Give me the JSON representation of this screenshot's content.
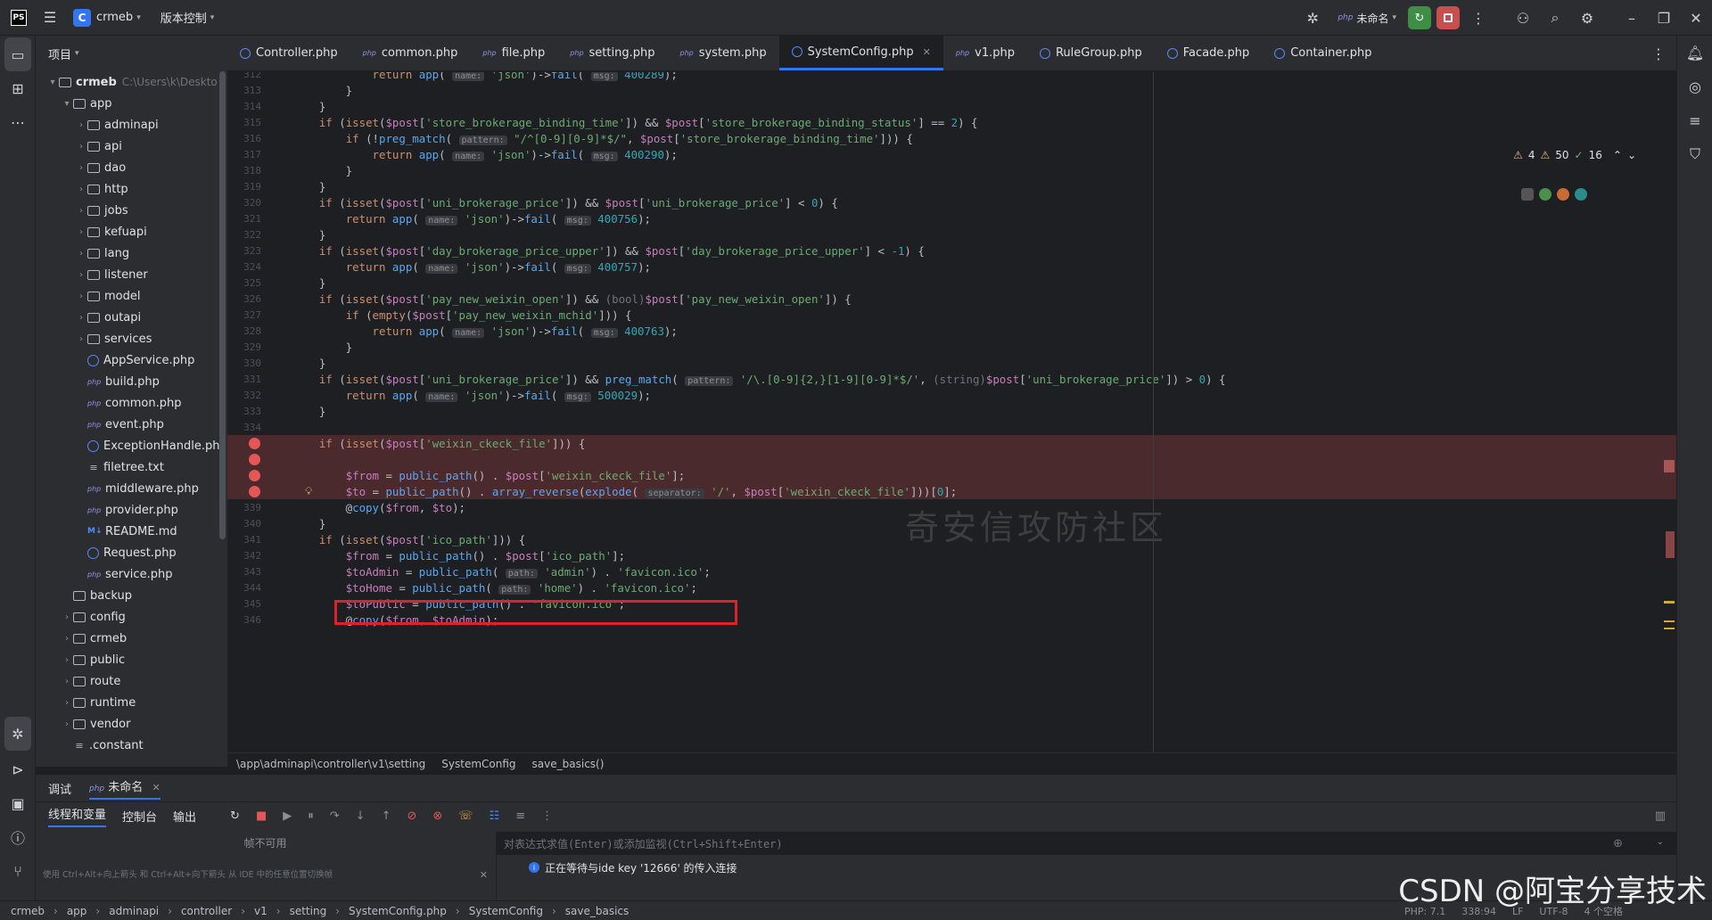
{
  "titlebar": {
    "logo_text": "PS",
    "project_badge": "C",
    "project_name": "crmeb",
    "vcs_label": "版本控制",
    "run_config": "未命名"
  },
  "project_panel": {
    "header": "项目",
    "root_name": "crmeb",
    "root_path": "C:\\Users\\k\\Deskto",
    "items": [
      {
        "name": "app",
        "type": "folder",
        "depth": 1,
        "open": true
      },
      {
        "name": "adminapi",
        "type": "folder",
        "depth": 2
      },
      {
        "name": "api",
        "type": "folder",
        "depth": 2
      },
      {
        "name": "dao",
        "type": "folder",
        "depth": 2
      },
      {
        "name": "http",
        "type": "folder",
        "depth": 2
      },
      {
        "name": "jobs",
        "type": "folder",
        "depth": 2
      },
      {
        "name": "kefuapi",
        "type": "folder",
        "depth": 2
      },
      {
        "name": "lang",
        "type": "folder",
        "depth": 2
      },
      {
        "name": "listener",
        "type": "folder",
        "depth": 2
      },
      {
        "name": "model",
        "type": "folder",
        "depth": 2
      },
      {
        "name": "outapi",
        "type": "folder",
        "depth": 2
      },
      {
        "name": "services",
        "type": "folder",
        "depth": 2
      },
      {
        "name": "AppService.php",
        "type": "class",
        "depth": 2
      },
      {
        "name": "build.php",
        "type": "php",
        "depth": 2
      },
      {
        "name": "common.php",
        "type": "php",
        "depth": 2
      },
      {
        "name": "event.php",
        "type": "php",
        "depth": 2
      },
      {
        "name": "ExceptionHandle.ph",
        "type": "class",
        "depth": 2
      },
      {
        "name": "filetree.txt",
        "type": "txt",
        "depth": 2
      },
      {
        "name": "middleware.php",
        "type": "php",
        "depth": 2
      },
      {
        "name": "provider.php",
        "type": "php",
        "depth": 2
      },
      {
        "name": "README.md",
        "type": "md",
        "depth": 2
      },
      {
        "name": "Request.php",
        "type": "class",
        "depth": 2
      },
      {
        "name": "service.php",
        "type": "php",
        "depth": 2
      },
      {
        "name": "backup",
        "type": "folder-noarrow",
        "depth": 1
      },
      {
        "name": "config",
        "type": "folder",
        "depth": 1
      },
      {
        "name": "crmeb",
        "type": "folder",
        "depth": 1
      },
      {
        "name": "public",
        "type": "folder",
        "depth": 1
      },
      {
        "name": "route",
        "type": "folder",
        "depth": 1
      },
      {
        "name": "runtime",
        "type": "folder",
        "depth": 1
      },
      {
        "name": "vendor",
        "type": "folder",
        "depth": 1
      },
      {
        "name": ".constant",
        "type": "txt",
        "depth": 1
      }
    ]
  },
  "tabs": [
    {
      "label": "Controller.php",
      "icon": "class"
    },
    {
      "label": "common.php",
      "icon": "php"
    },
    {
      "label": "file.php",
      "icon": "php"
    },
    {
      "label": "setting.php",
      "icon": "php"
    },
    {
      "label": "system.php",
      "icon": "php"
    },
    {
      "label": "SystemConfig.php",
      "icon": "class",
      "active": true
    },
    {
      "label": "v1.php",
      "icon": "php"
    },
    {
      "label": "RuleGroup.php",
      "icon": "class"
    },
    {
      "label": "Facade.php",
      "icon": "class"
    },
    {
      "label": "Container.php",
      "icon": "class"
    }
  ],
  "inspections": {
    "warnings_a": "4",
    "warnings_b": "50",
    "ok": "16"
  },
  "watermark": "奇安信攻防社区",
  "editor_breadcrumb": [
    "\\app\\adminapi\\controller\\v1\\setting",
    "SystemConfig",
    "save_basics()"
  ],
  "code_lines": [
    {
      "n": "312",
      "html": "            <span class='kw'>return</span> <span class='fn'>app</span>( <span class='hint'>name:</span> <span class='str'>'json'</span>)-&gt;<span class='fn'>fail</span>( <span class='hint'>msg:</span> <span class='num'>400289</span>);"
    },
    {
      "n": "313",
      "html": "        }"
    },
    {
      "n": "314",
      "html": "    }"
    },
    {
      "n": "315",
      "html": "    <span class='kw'>if</span> (<span class='kw'>isset</span>(<span class='var'>$post</span>[<span class='str'>'store_brokerage_binding_time'</span>]) &amp;&amp; <span class='var'>$post</span>[<span class='str'>'store_brokerage_binding_status'</span>] == <span class='num'>2</span>) {"
    },
    {
      "n": "316",
      "html": "        <span class='kw'>if</span> (!<span class='fn'>preg_match</span>( <span class='hint'>pattern:</span> <span class='str'>\"/^[0-9][0-9]*$/\"</span>, <span class='var'>$post</span>[<span class='str'>'store_brokerage_binding_time'</span>])) {"
    },
    {
      "n": "317",
      "html": "            <span class='kw'>return</span> <span class='fn'>app</span>( <span class='hint'>name:</span> <span class='str'>'json'</span>)-&gt;<span class='fn'>fail</span>( <span class='hint'>msg:</span> <span class='num'>400290</span>);"
    },
    {
      "n": "318",
      "html": "        }"
    },
    {
      "n": "319",
      "html": "    }"
    },
    {
      "n": "320",
      "html": "    <span class='kw'>if</span> (<span class='kw'>isset</span>(<span class='var'>$post</span>[<span class='str'>'uni_brokerage_price'</span>]) &amp;&amp; <span class='var'>$post</span>[<span class='str'>'uni_brokerage_price'</span>] &lt; <span class='num'>0</span>) {"
    },
    {
      "n": "321",
      "html": "        <span class='kw'>return</span> <span class='fn'>app</span>( <span class='hint'>name:</span> <span class='str'>'json'</span>)-&gt;<span class='fn'>fail</span>( <span class='hint'>msg:</span> <span class='num'>400756</span>);"
    },
    {
      "n": "322",
      "html": "    }"
    },
    {
      "n": "323",
      "html": "    <span class='kw'>if</span> (<span class='kw'>isset</span>(<span class='var'>$post</span>[<span class='str'>'day_brokerage_price_upper'</span>]) &amp;&amp; <span class='var'>$post</span>[<span class='str'>'day_brokerage_price_upper'</span>] &lt; <span class='num'>-1</span>) {"
    },
    {
      "n": "324",
      "html": "        <span class='kw'>return</span> <span class='fn'>app</span>( <span class='hint'>name:</span> <span class='str'>'json'</span>)-&gt;<span class='fn'>fail</span>( <span class='hint'>msg:</span> <span class='num'>400757</span>);"
    },
    {
      "n": "325",
      "html": "    }"
    },
    {
      "n": "326",
      "html": "    <span class='kw'>if</span> (<span class='kw'>isset</span>(<span class='var'>$post</span>[<span class='str'>'pay_new_weixin_open'</span>]) &amp;&amp; <span class='cast'>(bool)</span><span class='var'>$post</span>[<span class='str'>'pay_new_weixin_open'</span>]) {"
    },
    {
      "n": "327",
      "html": "        <span class='kw'>if</span> (<span class='kw'>empty</span>(<span class='var'>$post</span>[<span class='str'>'pay_new_weixin_mchid'</span>])) {"
    },
    {
      "n": "328",
      "html": "            <span class='kw'>return</span> <span class='fn'>app</span>( <span class='hint'>name:</span> <span class='str'>'json'</span>)-&gt;<span class='fn'>fail</span>( <span class='hint'>msg:</span> <span class='num'>400763</span>);"
    },
    {
      "n": "329",
      "html": "        }"
    },
    {
      "n": "330",
      "html": "    }"
    },
    {
      "n": "331",
      "html": "    <span class='kw'>if</span> (<span class='kw'>isset</span>(<span class='var'>$post</span>[<span class='str'>'uni_brokerage_price'</span>]) &amp;&amp; <span class='fn'>preg_match</span>( <span class='hint'>pattern:</span> <span class='str'>'/\\.[0-9]{2,}[1-9][0-9]*$/'</span>, <span class='cast'>(string)</span><span class='var'>$post</span>[<span class='str'>'uni_brokerage_price'</span>]) &gt; <span class='num'>0</span>) {"
    },
    {
      "n": "332",
      "html": "        <span class='kw'>return</span> <span class='fn'>app</span>( <span class='hint'>name:</span> <span class='str'>'json'</span>)-&gt;<span class='fn'>fail</span>( <span class='hint'>msg:</span> <span class='num'>500029</span>);"
    },
    {
      "n": "333",
      "html": "    }"
    },
    {
      "n": "334",
      "html": ""
    },
    {
      "n": "",
      "bp": true,
      "html": "    <span class='kw'>if</span> (<span class='kw'>isset</span>(<span class='var'>$post</span>[<span class='str'>'weixin_ckeck_file'</span>])) {"
    },
    {
      "n": "",
      "bp": true,
      "html": ""
    },
    {
      "n": "",
      "bp": true,
      "html": "        <span class='var'>$from</span> = <span class='fn'>public_path</span>() . <span class='var'>$post</span>[<span class='str'>'weixin_ckeck_file'</span>];"
    },
    {
      "n": "",
      "bp": true,
      "bulb": true,
      "html": "        <span class='var'>$to</span> = <span class='fn'>public_path</span>() . <span class='fn'>array_reverse</span>(<span class='fn'>explode</span>( <span class='hint'>separator:</span> <span class='str'>'/'</span>, <span class='var'>$post</span>[<span class='str'>'weixin_ckeck_file'</span>]))[<span class='num'>0</span>];"
    },
    {
      "n": "339",
      "html": "        @<span class='fn'>copy</span>(<span class='var'>$from</span>, <span class='var'>$to</span>);"
    },
    {
      "n": "340",
      "html": "    }"
    },
    {
      "n": "341",
      "html": "    <span class='kw'>if</span> (<span class='kw'>isset</span>(<span class='var'>$post</span>[<span class='str'>'ico_path'</span>])) {"
    },
    {
      "n": "342",
      "html": "        <span class='var'>$from</span> = <span class='fn'>public_path</span>() . <span class='var'>$post</span>[<span class='str'>'ico_path'</span>];"
    },
    {
      "n": "343",
      "html": "        <span class='var'>$toAdmin</span> = <span class='fn'>public_path</span>( <span class='hint'>path:</span> <span class='str'>'admin'</span>) . <span class='str'>'favicon.ico'</span>;"
    },
    {
      "n": "344",
      "html": "        <span class='var'>$toHome</span> = <span class='fn'>public_path</span>( <span class='hint'>path:</span> <span class='str'>'home'</span>) . <span class='str'>'favicon.ico'</span>;"
    },
    {
      "n": "345",
      "html": "        <span class='var'>$toPublic</span> = <span class='fn'>public_path</span>() . <span class='str'>'favicon.ico'</span>;"
    },
    {
      "n": "346",
      "html": "        @<span class='fn'>copy</span>(<span class='var'>$from</span>, <span class='var'>$toAdmin</span>);"
    }
  ],
  "debug": {
    "tab_debug": "调试",
    "tab_session": "未命名",
    "sub_threads": "线程和变量",
    "sub_console": "控制台",
    "sub_output": "输出",
    "frames_unavailable": "帧不可用",
    "frames_hint": "使用 Ctrl+Alt+向上箭头 和 Ctrl+Alt+向下箭头 从 IDE 中的任意位置切换帧",
    "eval_placeholder": "对表达式求值(Enter)或添加监视(Ctrl+Shift+Enter)",
    "waiting_msg": "正在等待与ide key '12666' 的传入连接"
  },
  "statusbar": {
    "crumbs": [
      "crmeb",
      "app",
      "adminapi",
      "controller",
      "v1",
      "setting",
      "SystemConfig.php",
      "SystemConfig",
      "save_basics"
    ],
    "php_version": "PHP: 7.1",
    "position": "338:94",
    "line_sep": "LF",
    "encoding": "UTF-8",
    "spaces": "4 个空格"
  },
  "csdn_watermark": "CSDN @阿宝分享技术"
}
